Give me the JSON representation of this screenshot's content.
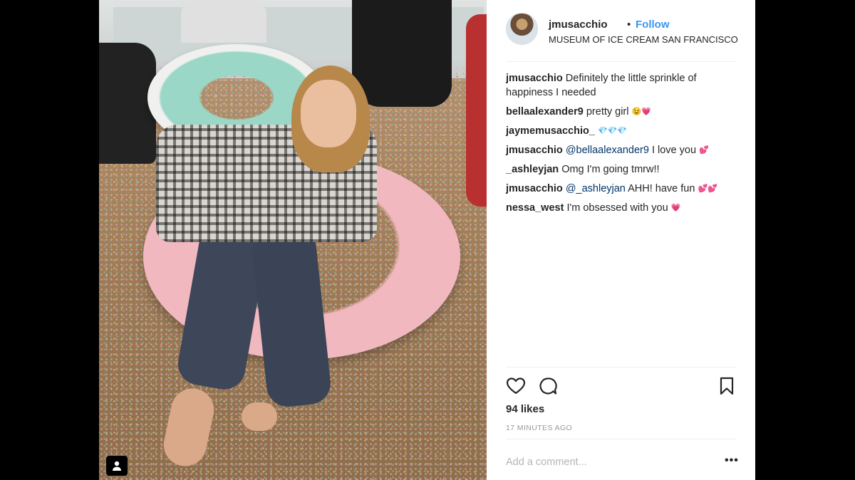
{
  "post": {
    "username": "jmusacchio",
    "separator": "•",
    "follow_label": "Follow",
    "location": "MUSEUM OF ICE CREAM SAN FRANCISCO"
  },
  "comments": [
    {
      "user": "jmusacchio",
      "text": " Definitely the little sprinkle of happiness I needed",
      "mention": "",
      "tail": "",
      "emoji": ""
    },
    {
      "user": "bellaalexander9",
      "text": " pretty girl ",
      "mention": "",
      "tail": "",
      "emoji": "😉💗"
    },
    {
      "user": "jaymemusacchio_",
      "text": " ",
      "mention": "",
      "tail": "",
      "emoji": "💎💎💎"
    },
    {
      "user": "jmusacchio",
      "text": " ",
      "mention": "@bellaalexander9",
      "tail": " I love you ",
      "emoji": "💕"
    },
    {
      "user": "_ashleyjan",
      "text": " Omg I'm going tmrw!!",
      "mention": "",
      "tail": "",
      "emoji": ""
    },
    {
      "user": "jmusacchio",
      "text": " ",
      "mention": "@_ashleyjan",
      "tail": " AHH! have fun ",
      "emoji": "💕💕"
    },
    {
      "user": "nessa_west",
      "text": " I'm obsessed with you ",
      "mention": "",
      "tail": "",
      "emoji": "💗"
    }
  ],
  "actions": {
    "like_icon": "heart-icon",
    "comment_icon": "comment-icon",
    "save_icon": "bookmark-icon"
  },
  "likes_text": "94 likes",
  "time_text": "17 MINUTES AGO",
  "add_comment_placeholder": "Add a comment...",
  "more_label": "•••",
  "colors": {
    "link": "#3897f0",
    "text": "#262626",
    "muted": "#999999",
    "mention": "#003569"
  }
}
